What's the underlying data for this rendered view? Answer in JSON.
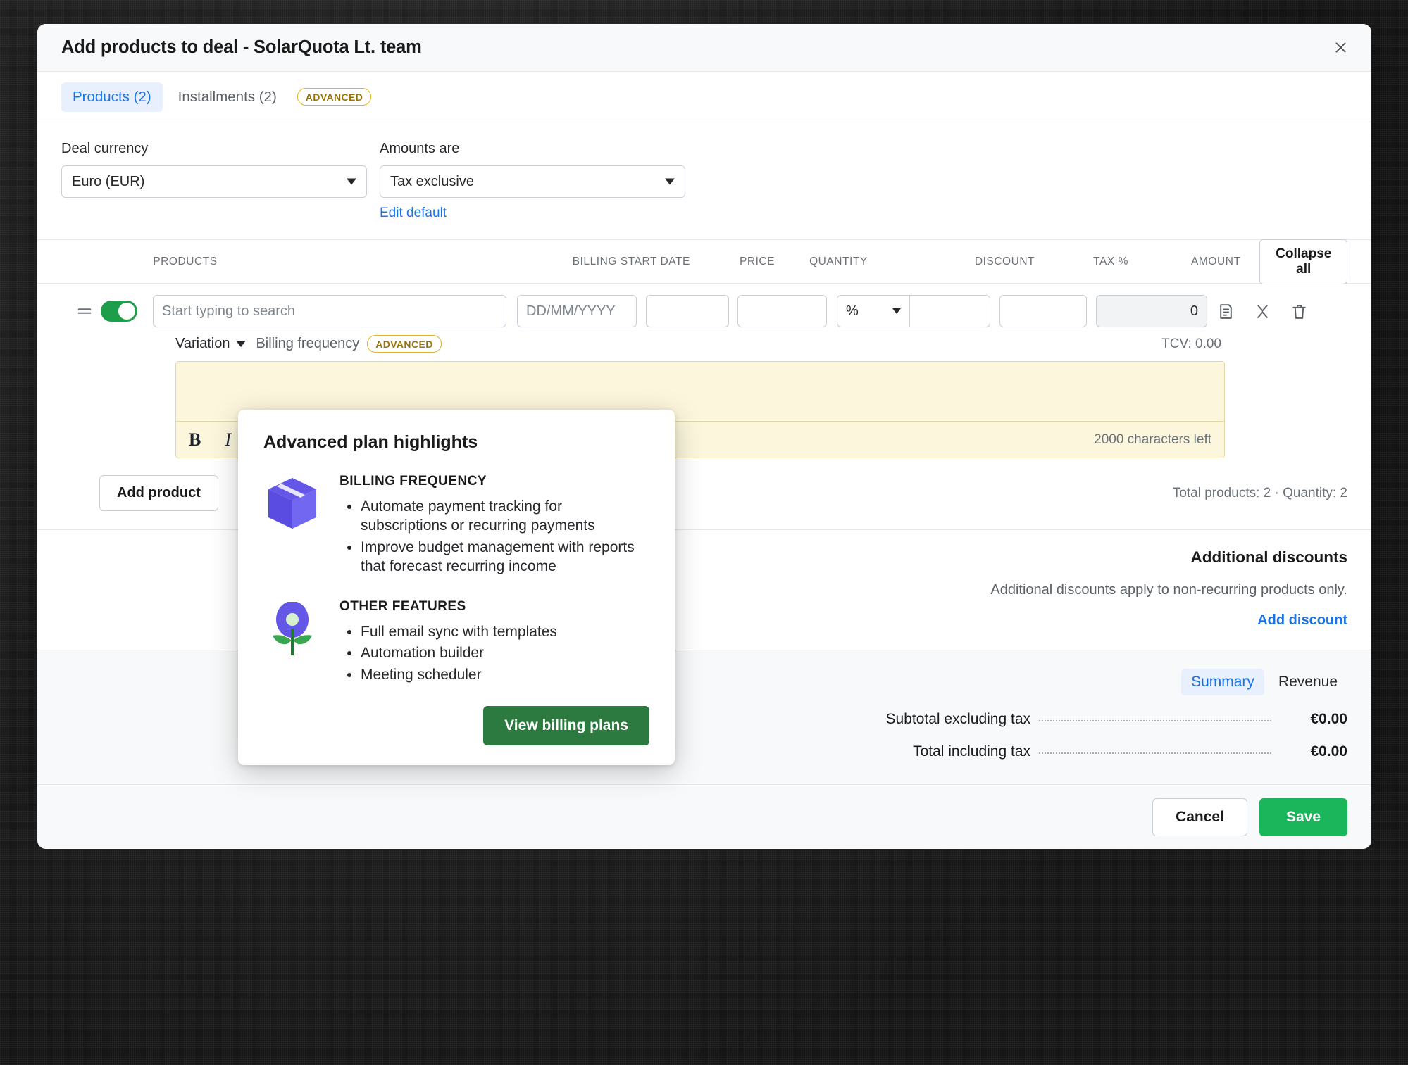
{
  "window": {
    "title": "Add products to deal - SolarQuota Lt. team",
    "close_icon": "close-icon"
  },
  "tabs": [
    {
      "label": "Products (2)",
      "active": true,
      "badge": null
    },
    {
      "label": "Installments (2)",
      "active": false,
      "badge": "ADVANCED"
    }
  ],
  "form": {
    "currency_label": "Deal currency",
    "currency_value": "Euro (EUR)",
    "amounts_label": "Amounts are",
    "amounts_value": "Tax exclusive",
    "edit_default_link": "Edit default"
  },
  "table": {
    "headers": {
      "products": "PRODUCTS",
      "billing_start_date": "BILLING START DATE",
      "price": "PRICE",
      "quantity": "QUANTITY",
      "discount": "DISCOUNT",
      "tax": "TAX %",
      "amount": "AMOUNT"
    },
    "collapse_all": "Collapse all",
    "row": {
      "search_placeholder": "Start typing to search",
      "search_value": "",
      "date_placeholder": "DD/MM/YYYY",
      "date_value": "",
      "price_value": "",
      "quantity_value": "",
      "discount_type": "%",
      "discount_value": "",
      "tax_value": "",
      "amount_value": "0",
      "toggle_on": true,
      "variation_label": "Variation",
      "billing_frequency_label": "Billing frequency",
      "billing_frequency_badge": "ADVANCED",
      "tcv": "TCV: 0.00",
      "icons": [
        "note-icon",
        "collapse-icon",
        "delete-icon"
      ]
    },
    "editor": {
      "value": "",
      "bold_label": "B",
      "italic_label": "I",
      "chars_left": "2000 characters left"
    },
    "add_product_label": "Add product",
    "totals_meta": "Total products: 2  ·  Quantity: 2"
  },
  "discounts": {
    "title": "Additional discounts",
    "description": "Additional discounts apply to non-recurring products only.",
    "add_link": "Add discount"
  },
  "summary": {
    "tabs": [
      {
        "label": "Summary",
        "active": true
      },
      {
        "label": "Revenue",
        "active": false
      }
    ],
    "lines": [
      {
        "label": "Subtotal excluding tax",
        "value": "€0.00"
      },
      {
        "label": "Total including tax",
        "value": "€0.00"
      }
    ]
  },
  "footer": {
    "cancel_label": "Cancel",
    "save_label": "Save"
  },
  "popover": {
    "title": "Advanced plan highlights",
    "sections": [
      {
        "icon": "package-box-icon",
        "heading": "BILLING FREQUENCY",
        "items": [
          "Automate payment tracking for subscriptions or recurring payments",
          "Improve budget management with reports that forecast recurring income"
        ]
      },
      {
        "icon": "flower-icon",
        "heading": "OTHER FEATURES",
        "items": [
          "Full email sync with templates",
          "Automation builder",
          "Meeting scheduler"
        ]
      }
    ],
    "cta_label": "View billing plans"
  },
  "colors": {
    "accent_blue": "#1a73e8",
    "save_green": "#1bb55c",
    "cta_green": "#2d7a41",
    "toggle_green": "#1e9e4a",
    "badge_gold": "#e0b526",
    "editor_bg": "#fbf6dc",
    "icon_purple": "#6457e8",
    "icon_green": "#3aa650"
  }
}
